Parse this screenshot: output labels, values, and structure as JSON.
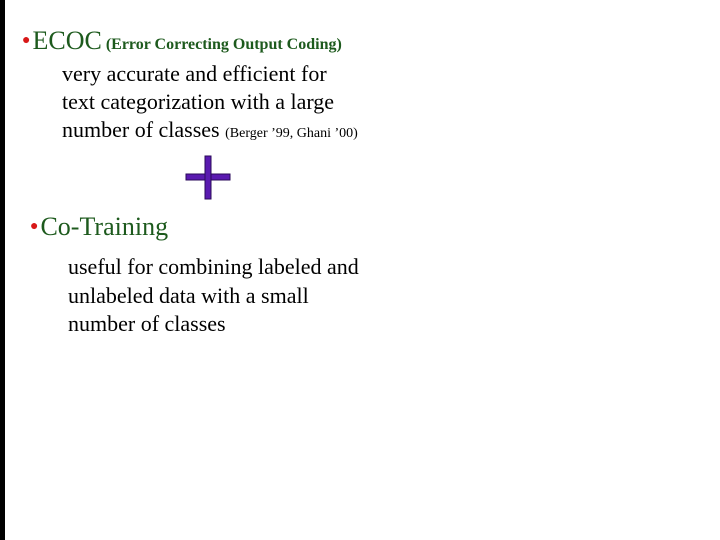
{
  "sections": [
    {
      "title": "ECOC",
      "subtitle": "(Error Correcting Output Coding)",
      "lines": [
        "very accurate and efficient for",
        "text categorization with a large",
        "number of classes"
      ],
      "citation": "(Berger ’99, Ghani ’00)"
    },
    {
      "title": "Co-Training",
      "lines": [
        "useful for combining labeled and",
        "unlabeled data with a small",
        "number of classes"
      ]
    }
  ],
  "connector": {
    "icon": "plus-icon",
    "color": "#5a1ab0"
  },
  "colors": {
    "heading": "#1d5a1d",
    "bullet": "#d81818",
    "body": "#000000"
  }
}
